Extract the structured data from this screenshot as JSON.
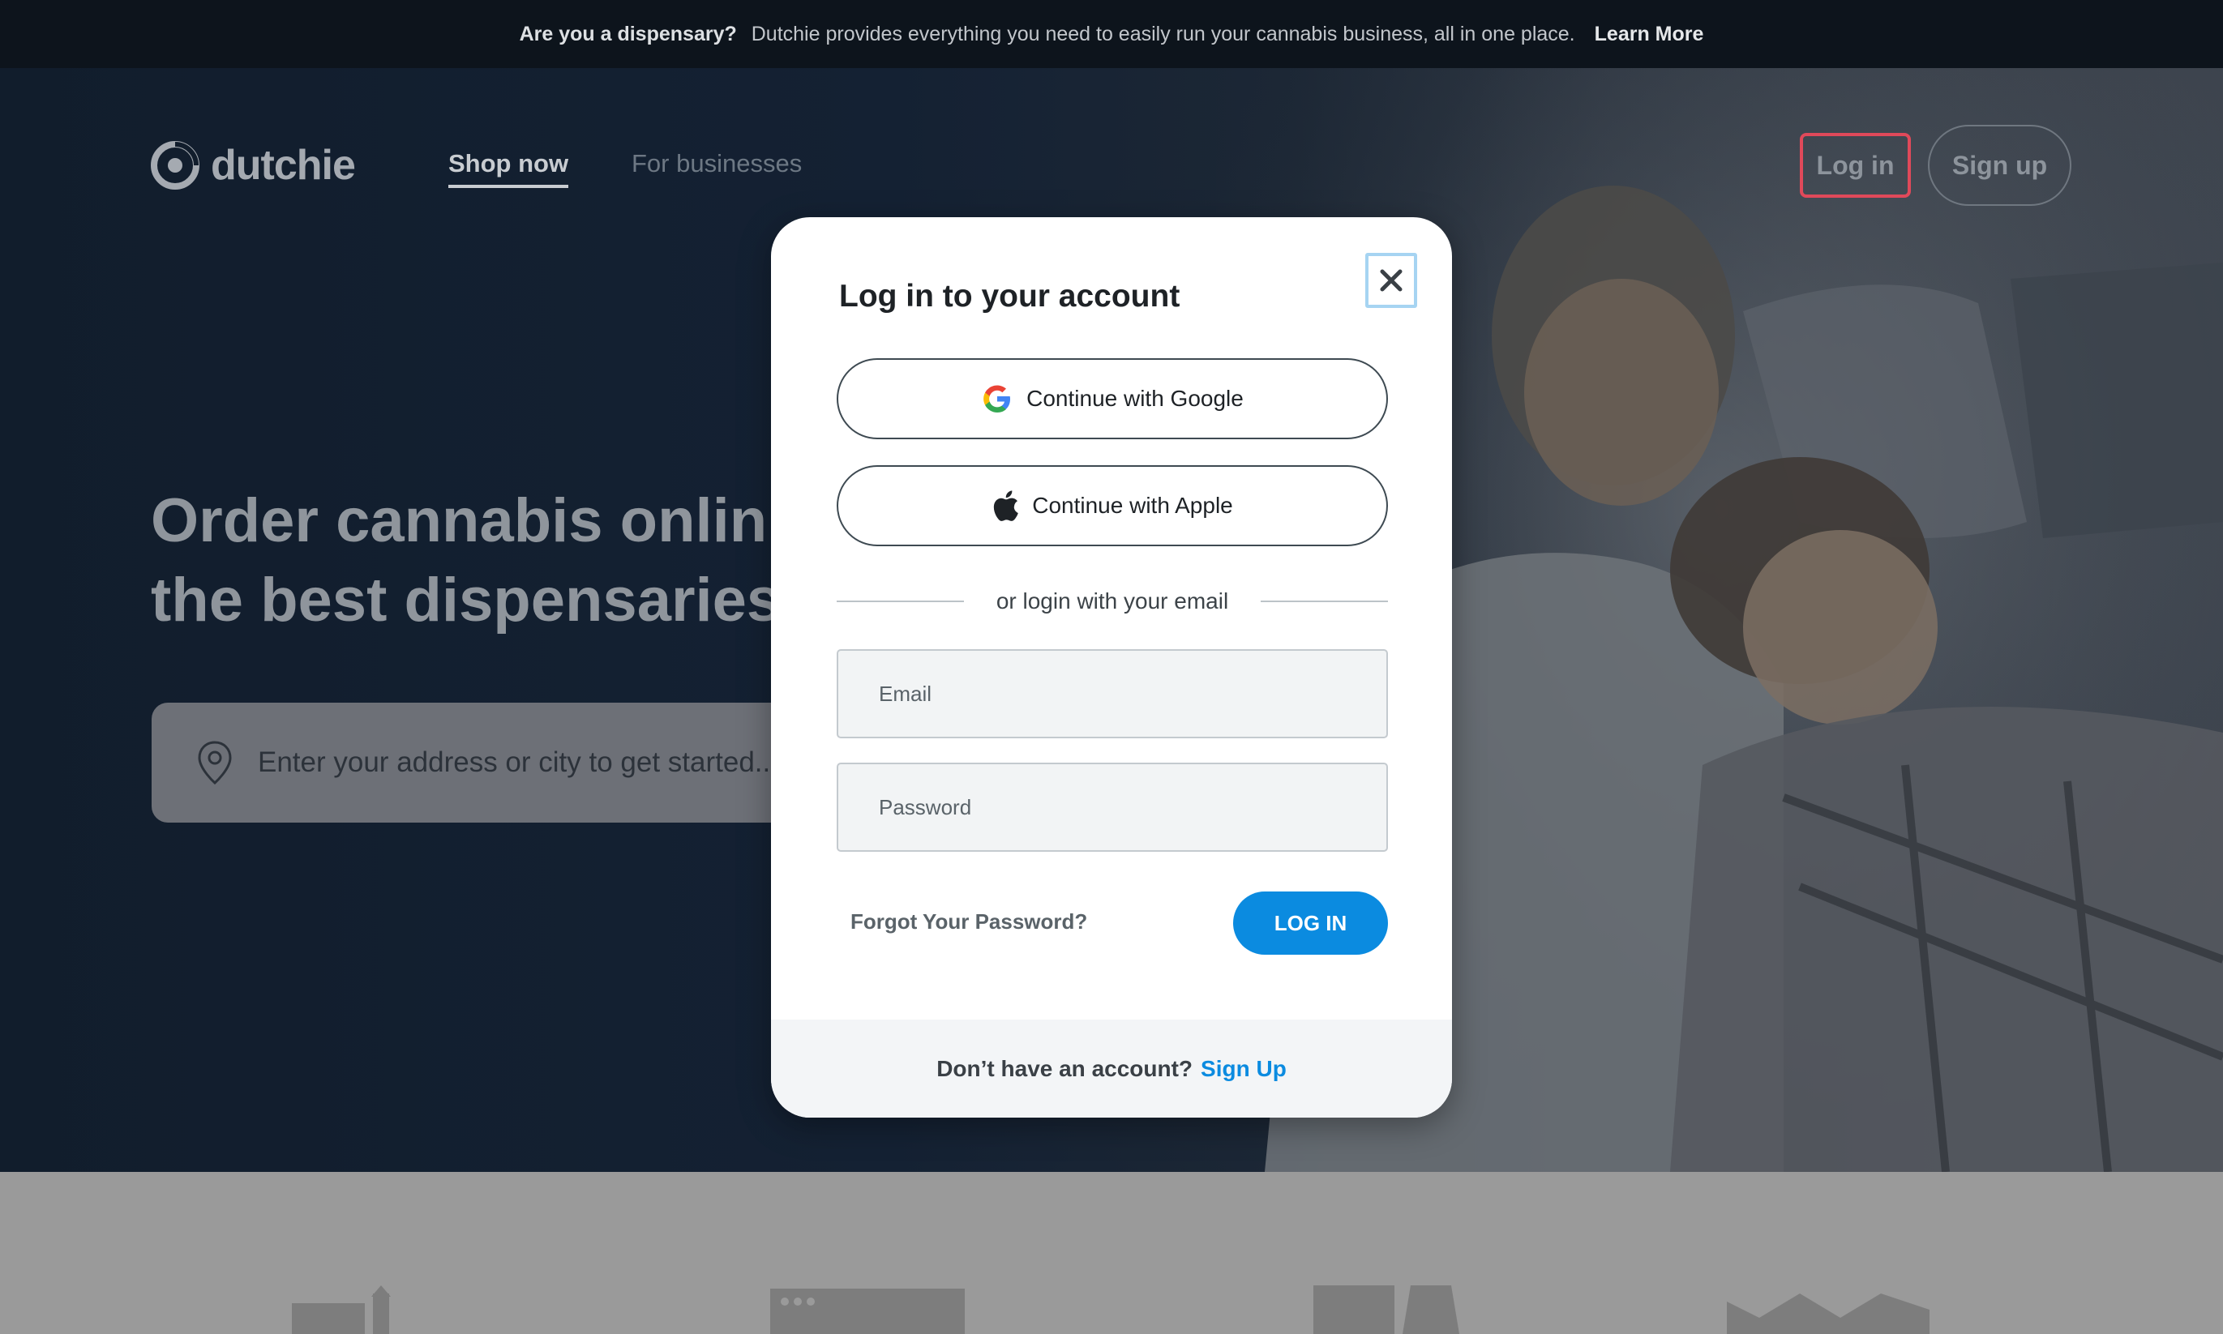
{
  "topbar": {
    "question": "Are you a dispensary?",
    "message": "Dutchie provides everything you need to easily run your cannabis business, all in one place.",
    "link": "Learn More"
  },
  "header": {
    "brand": "dutchie",
    "nav": [
      "Shop now",
      "For businesses"
    ],
    "login": "Log in",
    "signup": "Sign up"
  },
  "hero": {
    "headline_line1": "Order cannabis onlin",
    "headline_line2": "the best dispensaries",
    "search_placeholder": "Enter your address or city to get started..."
  },
  "modal": {
    "title": "Log in to your account",
    "google": "Continue with Google",
    "apple": "Continue with Apple",
    "divider": "or login with your email",
    "email_placeholder": "Email",
    "password_placeholder": "Password",
    "forgot": "Forgot Your Password?",
    "login_button": "LOG IN",
    "footer_text": "Don’t have an account?",
    "footer_link": "Sign Up"
  },
  "colors": {
    "accent": "#0b8be0",
    "login_highlight": "#e0495a",
    "topbar_bg": "#0d141c",
    "hero_bg": "#111d2c"
  },
  "icons": [
    "dutchie-logo-icon",
    "location-pin-icon",
    "close-icon",
    "google-icon",
    "apple-icon"
  ]
}
